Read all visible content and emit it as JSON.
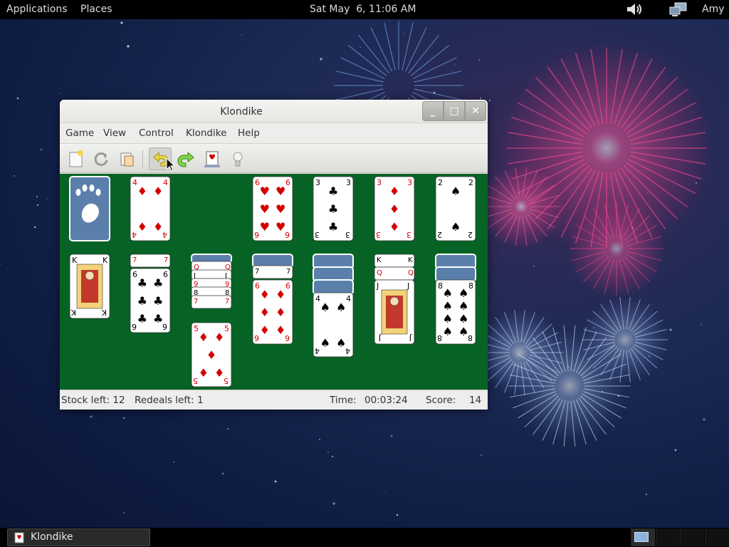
{
  "top_panel": {
    "applications": "Applications",
    "places": "Places",
    "clock": "Sat May  6, 11:06 AM",
    "user": "Amy",
    "volume_icon": "speaker-volume-icon",
    "network_icon": "network-computers-icon"
  },
  "window": {
    "title": "Klondike",
    "controls": {
      "minimize": "_",
      "maximize": "□",
      "close": "✕"
    },
    "menu": [
      "Game",
      "View",
      "Control",
      "Klondike",
      "Help"
    ],
    "toolbar_icons": [
      "new-game-icon",
      "restart-icon",
      "hint-icon",
      "undo-icon",
      "redo-icon",
      "select-game-icon",
      "fullscreen-icon"
    ],
    "colors": {
      "felt": "#076325",
      "red_suit": "#d40000",
      "card_back": "#5a7fab"
    }
  },
  "board": {
    "foundations": [
      {
        "rank": "4",
        "suit": "♦",
        "color": "red"
      },
      {
        "rank": "6",
        "suit": "♥",
        "color": "red"
      },
      {
        "rank": "3",
        "suit": "♣",
        "color": "black"
      },
      {
        "rank": "3",
        "suit": "♦",
        "color": "red"
      },
      {
        "rank": "2",
        "suit": "♠",
        "color": "black"
      }
    ],
    "tableau_top_cards": [
      {
        "rank": "K",
        "suit": "♣",
        "color": "black"
      },
      {
        "rank": "6",
        "suit": "♣",
        "color": "black"
      },
      {
        "rank": "5",
        "suit": "♦",
        "color": "red"
      },
      {
        "rank": "6",
        "suit": "♦",
        "color": "red"
      },
      {
        "rank": "4",
        "suit": "♠",
        "color": "black"
      },
      {
        "rank": "J",
        "suit": "♠",
        "color": "black"
      },
      {
        "rank": "8",
        "suit": "♠",
        "color": "black"
      }
    ],
    "tableau_partial_ranks": {
      "col2": [
        "7"
      ],
      "col3": [
        "Q",
        "J",
        "9",
        "8",
        "7"
      ],
      "col4": [
        "7"
      ],
      "col6": [
        "K",
        "Q"
      ]
    }
  },
  "status": {
    "stock_left": "Stock left: 12",
    "redeals_left": "Redeals left: 1",
    "time_label": "Time:",
    "time_value": "00:03:24",
    "score_label": "Score:",
    "score_value": "14"
  },
  "taskbar": {
    "window_button": "Klondike",
    "workspaces": [
      "workspace-1",
      "workspace-2",
      "workspace-3",
      "workspace-4"
    ]
  }
}
